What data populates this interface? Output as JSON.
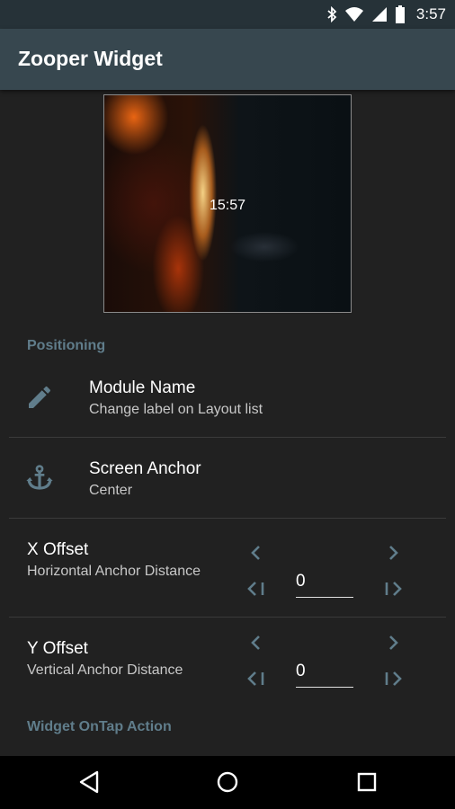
{
  "status_bar": {
    "time": "3:57",
    "icons": [
      "bluetooth-icon",
      "wifi-icon",
      "cell-signal-icon",
      "battery-icon"
    ]
  },
  "app_bar": {
    "title": "Zooper Widget"
  },
  "preview": {
    "time": "15:57"
  },
  "sections": {
    "positioning": "Positioning",
    "ontap": "Widget OnTap Action"
  },
  "module_name": {
    "title": "Module Name",
    "subtitle": "Change label on Layout list",
    "icon": "pencil-icon"
  },
  "screen_anchor": {
    "title": "Screen Anchor",
    "subtitle": "Center",
    "icon": "anchor-icon"
  },
  "x_offset": {
    "title": "X Offset",
    "subtitle": "Horizontal Anchor Distance",
    "value": "0"
  },
  "y_offset": {
    "title": "Y Offset",
    "subtitle": "Vertical Anchor Distance",
    "value": "0"
  },
  "colors": {
    "accent": "#607d8b",
    "appbar": "#37474f",
    "statusbar": "#263238",
    "background": "#212121"
  },
  "nav_bar": {
    "icons": [
      "back-icon",
      "home-icon",
      "recents-icon"
    ]
  }
}
